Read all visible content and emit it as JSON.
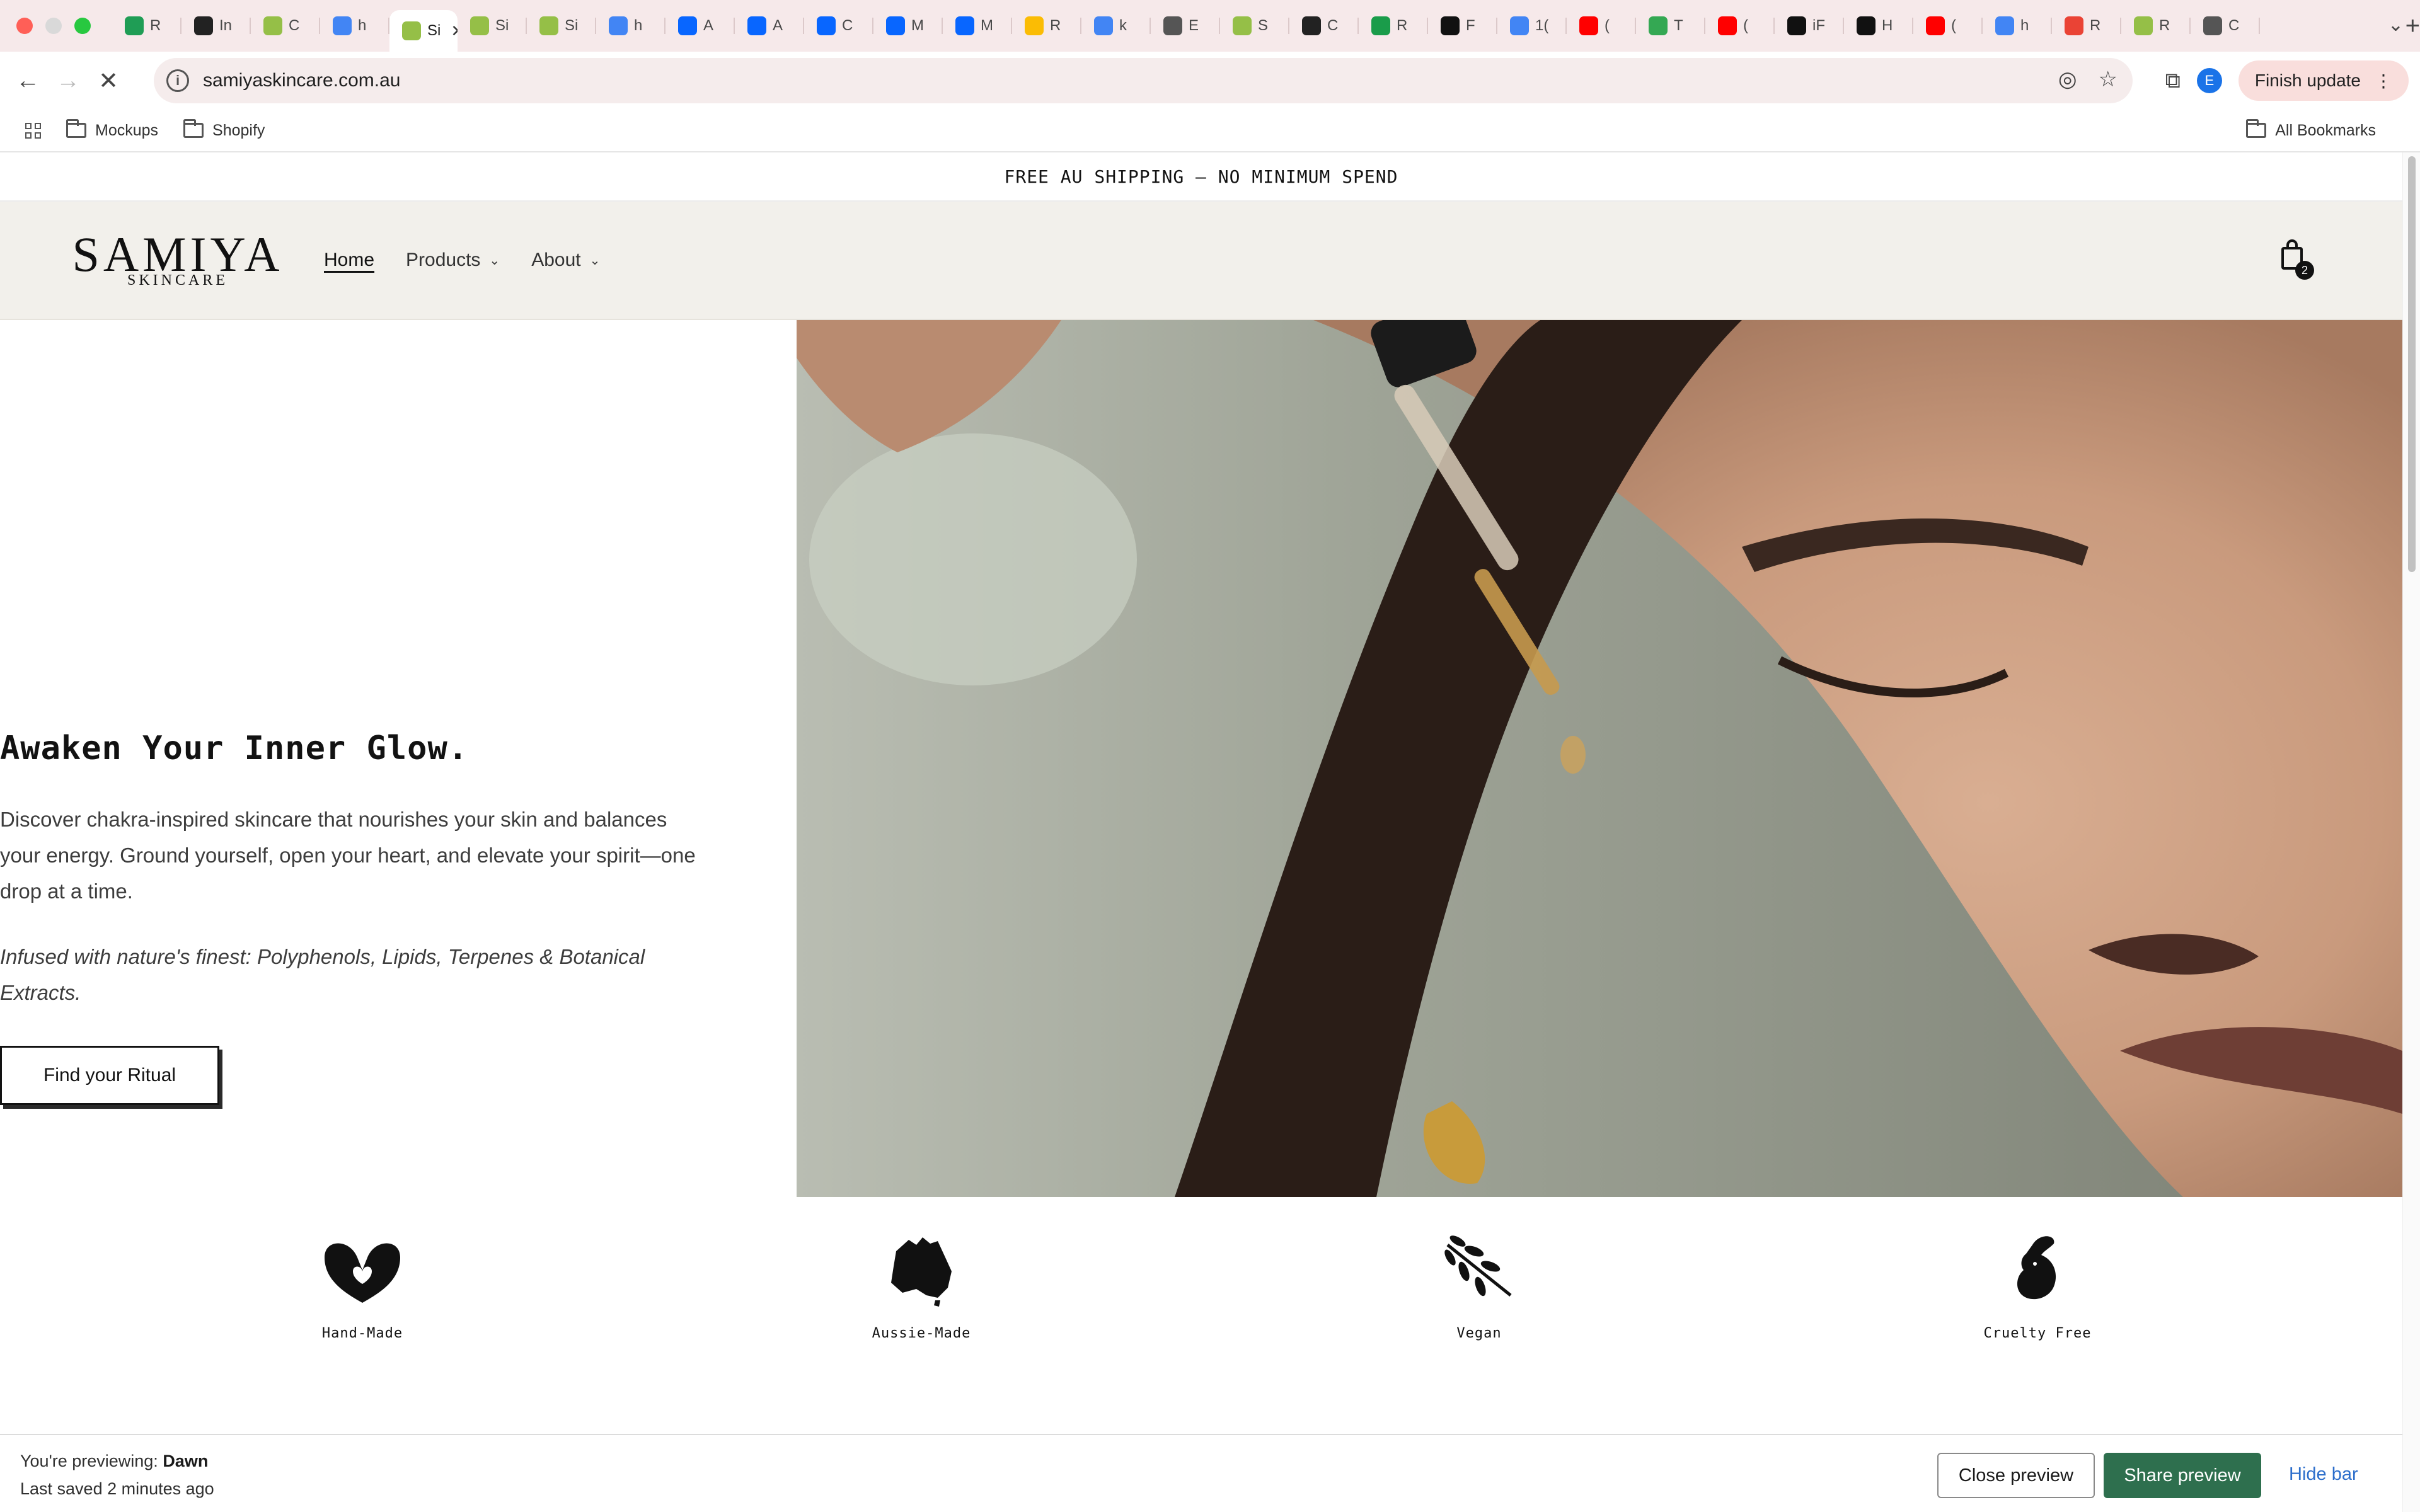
{
  "browser": {
    "tabs": [
      {
        "label": "R",
        "icon": "shopify-icon",
        "color": "#1f9d55"
      },
      {
        "label": "In",
        "icon": "threads-icon",
        "color": "#222222"
      },
      {
        "label": "C",
        "icon": "shopify-icon",
        "color": "#95bf47"
      },
      {
        "label": "h",
        "icon": "google-icon",
        "color": "#4285f4"
      },
      {
        "label": "Si",
        "icon": "shopify-icon",
        "color": "#95bf47",
        "active": true
      },
      {
        "label": "Si",
        "icon": "shopify-icon",
        "color": "#95bf47"
      },
      {
        "label": "Si",
        "icon": "shopify-icon",
        "color": "#95bf47"
      },
      {
        "label": "h",
        "icon": "google-icon",
        "color": "#4285f4"
      },
      {
        "label": "A",
        "icon": "meta-icon",
        "color": "#0866ff"
      },
      {
        "label": "A",
        "icon": "meta-icon",
        "color": "#0866ff"
      },
      {
        "label": "C",
        "icon": "meta-icon",
        "color": "#0866ff"
      },
      {
        "label": "M",
        "icon": "meta-icon",
        "color": "#0866ff"
      },
      {
        "label": "M",
        "icon": "meta-icon",
        "color": "#0866ff"
      },
      {
        "label": "R",
        "icon": "drive-icon",
        "color": "#fbbc04"
      },
      {
        "label": "k",
        "icon": "google-icon",
        "color": "#4285f4"
      },
      {
        "label": "E",
        "icon": "leaf-icon",
        "color": "#555555"
      },
      {
        "label": "S",
        "icon": "shopify-icon",
        "color": "#95bf47"
      },
      {
        "label": "C",
        "icon": "threads-icon",
        "color": "#222222"
      },
      {
        "label": "R",
        "icon": "plus-square-icon",
        "color": "#1a9c4a"
      },
      {
        "label": "F",
        "icon": "notion-icon",
        "color": "#111111"
      },
      {
        "label": "1(",
        "icon": "google-icon",
        "color": "#4285f4"
      },
      {
        "label": "(",
        "icon": "youtube-icon",
        "color": "#ff0000"
      },
      {
        "label": "T",
        "icon": "shield-icon",
        "color": "#34a853"
      },
      {
        "label": "(",
        "icon": "youtube-icon",
        "color": "#ff0000"
      },
      {
        "label": "iF",
        "icon": "medium-icon",
        "color": "#111111"
      },
      {
        "label": "H",
        "icon": "tiktok-icon",
        "color": "#111111"
      },
      {
        "label": "(",
        "icon": "youtube-icon",
        "color": "#ff0000"
      },
      {
        "label": "h",
        "icon": "google-icon",
        "color": "#4285f4"
      },
      {
        "label": "R",
        "icon": "gmail-icon",
        "color": "#ea4335"
      },
      {
        "label": "R",
        "icon": "shopify-icon",
        "color": "#95bf47"
      },
      {
        "label": "C",
        "icon": "leaf-icon",
        "color": "#555555"
      }
    ],
    "close_glyph": "✕",
    "new_tab_glyph": "+",
    "url": "samiyaskincare.com.au",
    "avatar_letter": "E",
    "finish_update": "Finish update",
    "bookmarks": [
      "Mockups",
      "Shopify"
    ],
    "all_bookmarks": "All Bookmarks"
  },
  "site": {
    "announcement": "FREE AU SHIPPING – NO MINIMUM SPEND",
    "logo_main": "SAMIYA",
    "logo_sub": "SKINCARE",
    "nav": {
      "home": "Home",
      "products": "Products",
      "about": "About"
    },
    "cart_count": "2",
    "hero": {
      "title": "Awaken Your Inner Glow.",
      "description": "Discover chakra-inspired skincare that nourishes your skin and balances your energy. Ground yourself, open your heart, and elevate your spirit—one drop at a time.",
      "ingredients": "Infused with nature's finest: Polyphenols, Lipids, Terpenes & Botanical Extracts.",
      "cta": "Find your Ritual"
    },
    "features": [
      {
        "label": "Hand-Made",
        "icon": "heart-hands-icon"
      },
      {
        "label": "Aussie-Made",
        "icon": "australia-map-icon"
      },
      {
        "label": "Vegan",
        "icon": "leaf-branch-icon"
      },
      {
        "label": "Cruelty Free",
        "icon": "bunny-icon"
      }
    ]
  },
  "preview_bar": {
    "previewing_prefix": "You're previewing:",
    "theme": "Dawn",
    "saved": "Last saved 2 minutes ago",
    "close": "Close preview",
    "share": "Share preview",
    "hide": "Hide bar"
  },
  "colors": {
    "tabstrip": "#f6e9ea",
    "header_bg": "#f2f0eb",
    "share_button": "#2e6f4e",
    "hide_link": "#2c6ecb"
  }
}
